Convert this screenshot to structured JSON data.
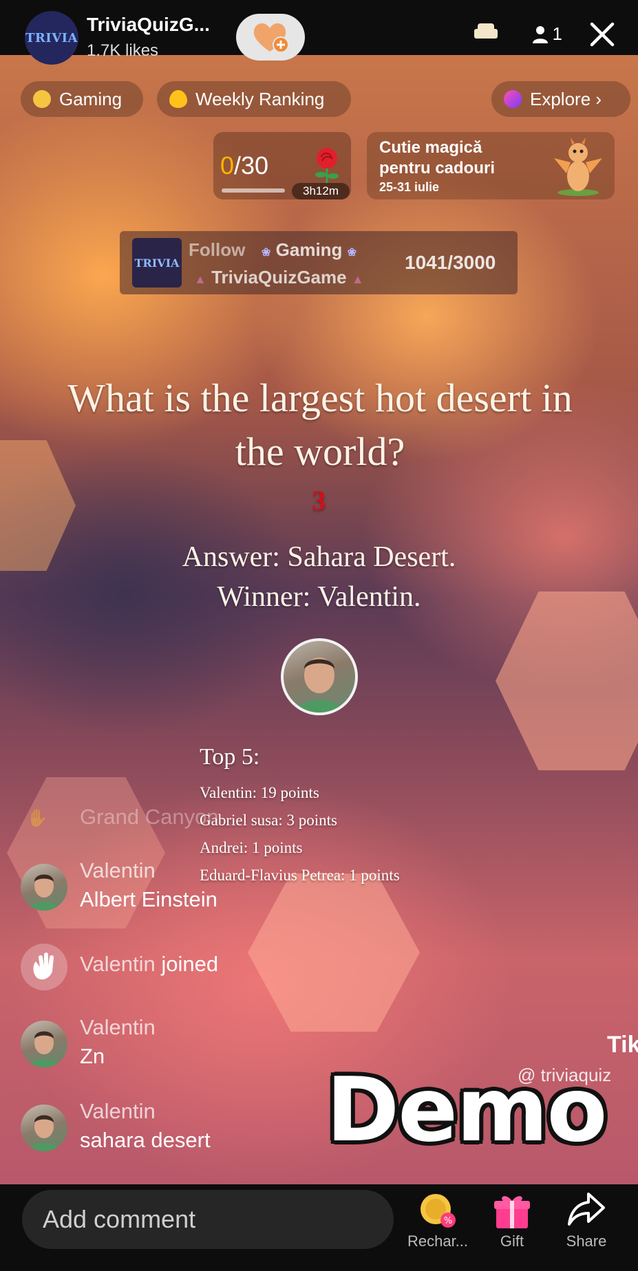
{
  "header": {
    "logo_text": "TRIVIA",
    "host_name": "TriviaQuizG...",
    "likes": "1.7K likes",
    "viewer_count": "1"
  },
  "pills": {
    "gaming": "Gaming",
    "weekly_ranking": "Weekly Ranking",
    "explore": "Explore ›"
  },
  "goal": {
    "progress": "/30",
    "progress_current": "0",
    "timer": "3h12m"
  },
  "promo": {
    "title": "Cutie magică pentru cadouri",
    "dates": "25-31 iulie"
  },
  "follow_card": {
    "follow_label": "Follow",
    "category": "Gaming",
    "channel": "TriviaQuizGame",
    "progress": "1041/3000"
  },
  "quiz": {
    "question": "What is the largest hot desert in the world?",
    "countdown": "3",
    "answer": "Answer: Sahara Desert.",
    "winner": "Winner: Valentin.",
    "top5_title": "Top 5:",
    "top5": [
      "Valentin: 19 points",
      "Gabriel susa: 3 points",
      "Andrei: 1 points",
      "Eduard-Flavius Petrea: 1 points"
    ]
  },
  "chat": {
    "faded_message": "Grand Canyon",
    "messages": [
      {
        "name": "Valentin",
        "text": "Albert Einstein"
      },
      {
        "name": "Valentin",
        "text": "joined"
      },
      {
        "name": "Valentin",
        "text": "Zn"
      },
      {
        "name": "Valentin",
        "text": "sahara desert"
      }
    ]
  },
  "overlay": {
    "demo": "Demo",
    "tk": "Tik",
    "handle": "@ triviaquiz"
  },
  "bottom": {
    "comment_placeholder": "Add comment",
    "recharge": "Rechar...",
    "gift": "Gift",
    "share": "Share"
  },
  "colors": {
    "accent_gold": "#ffb300",
    "countdown_red": "#d0101a"
  }
}
